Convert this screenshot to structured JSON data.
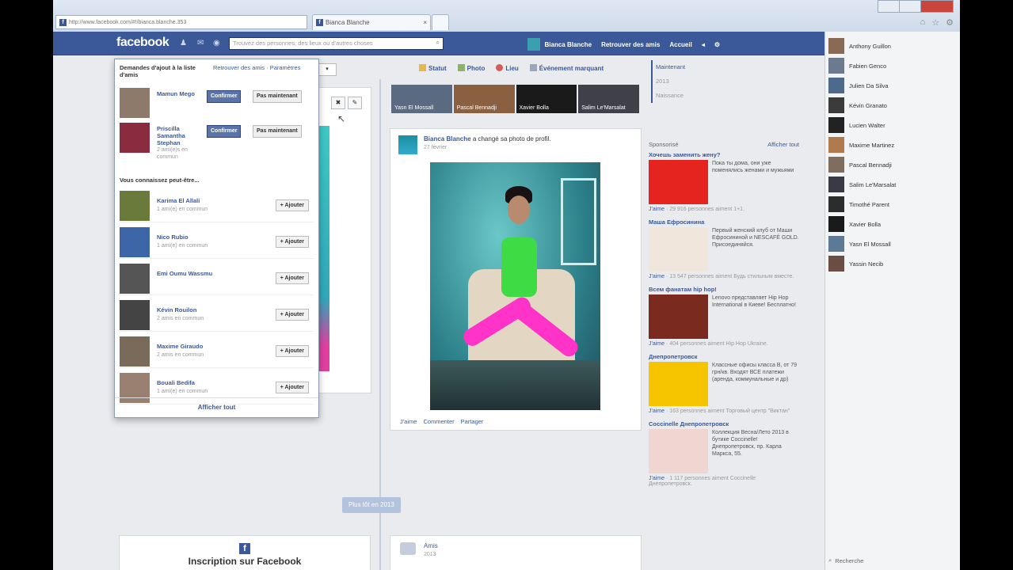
{
  "browser": {
    "url": "http://www.facebook.com/#!/bianca.blanche.353",
    "tab_label": "Bianca Blanche"
  },
  "fbbar": {
    "logo": "facebook",
    "search_placeholder": "Trouvez des personnes, des lieux ou d'autres choses",
    "profile_name": "Bianca Blanche",
    "find_friends": "Retrouver des amis",
    "home": "Accueil"
  },
  "actionbar": {
    "status": "Statut",
    "photo": "Photo",
    "place": "Lieu",
    "event": "Événement marquant"
  },
  "photostrip": [
    "Yasn El Mossall",
    "Pascal Bennadji",
    "Xavier Bolla",
    "Salim Le'Marsalat"
  ],
  "post": {
    "author": "Bianca Blanche",
    "action": "a changé sa photo de profil.",
    "time": "27 février",
    "like": "J'aime",
    "comment": "Commenter",
    "share": "Partager"
  },
  "yearnav": [
    "Maintenant",
    "2013",
    "Naissance"
  ],
  "more_button": "Plus tôt en 2013",
  "signup": "Inscription sur Facebook",
  "amis": {
    "title": "Amis",
    "year": "2013"
  },
  "sponsored": {
    "label": "Sponsorisé",
    "show_all": "Afficher tout",
    "ads": [
      {
        "title": "Хочешь заменить жену?",
        "text": "Пока ты дома, они уже поменялись женами и мужьями",
        "like": "J'aime",
        "count": "29 916 personnes aiment 1+1.",
        "color": "#e52420"
      },
      {
        "title": "Маша Ефросинина",
        "text": "Первый женский клуб от Маши Ефросининой и NESCAFÉ GOLD. Присоединяйся.",
        "like": "J'aime",
        "count": "13 547 personnes aiment Будь стильным вместе.",
        "color": "#f1e6dc"
      },
      {
        "title": "Всем фанатам hip hop!",
        "text": "Lenovo представляет Hip Hop International в Киеве! Бесплатно!",
        "like": "J'aime",
        "count": "404 personnes aiment Hip Hop Ukraine.",
        "color": "#7a2a1f"
      },
      {
        "title": "Днепропетровск",
        "text": "Классные офисы класса B, от 79 грн/кв. Входят ВСЕ платежи (аренда, коммунальные и др)",
        "like": "J'aime",
        "count": "163 personnes aiment Торговый центр \"Виктан\"",
        "color": "#f7c400"
      },
      {
        "title": "Coccinelle Днепропетровск",
        "text": "Коллекция Весна/Лето 2013 в бутике Coccinelle! Днепропетровск, пр. Карла Маркса, 55.",
        "like": "J'aime",
        "count": "1 117 personnes aiment Coccinelle Днепропетровск.",
        "color": "#f0d6d0"
      }
    ]
  },
  "dropdown": {
    "title": "Demandes d'ajout à la liste d'amis",
    "find": "Retrouver des amis",
    "settings": "Paramètres",
    "requests": [
      {
        "name": "Mamun Mego",
        "mutual": "",
        "confirm": "Confirmer",
        "later": "Pas maintenant"
      },
      {
        "name": "Priscilla Samantha Stephan",
        "mutual": "2 ami(e)s en commun",
        "confirm": "Confirmer",
        "later": "Pas maintenant"
      }
    ],
    "suggest_title": "Vous connaissez peut-être...",
    "suggestions": [
      {
        "name": "Karima El Allali",
        "mutual": "1 ami(e) en commun",
        "add": "Ajouter"
      },
      {
        "name": "Nico Rubio",
        "mutual": "1 ami(e) en commun",
        "add": "Ajouter"
      },
      {
        "name": "Emi Oumu Wassmu",
        "mutual": "",
        "add": "Ajouter"
      },
      {
        "name": "Kévin Rouilon",
        "mutual": "2 amis en commun",
        "add": "Ajouter"
      },
      {
        "name": "Maxime Giraudo",
        "mutual": "2 amis en commun",
        "add": "Ajouter"
      },
      {
        "name": "Bouali Bedifa",
        "mutual": "1 ami(e) en commun",
        "add": "Ajouter"
      }
    ],
    "show_all": "Afficher tout"
  },
  "chat": {
    "friends": [
      {
        "name": "Anthony Guillon",
        "color": "#8a6a55"
      },
      {
        "name": "Fabien Genco",
        "color": "#6c7a90"
      },
      {
        "name": "Julien Da Silva",
        "color": "#4d6a8c"
      },
      {
        "name": "Kévin Granato",
        "color": "#3b3b3b"
      },
      {
        "name": "Lucien Walter",
        "color": "#222"
      },
      {
        "name": "Maxime Martinez",
        "color": "#b07a4e"
      },
      {
        "name": "Pascal Bennadji",
        "color": "#7f6d60"
      },
      {
        "name": "Salim Le'Marsalat",
        "color": "#3a3a45"
      },
      {
        "name": "Timothé Parent",
        "color": "#2c2c2c"
      },
      {
        "name": "Xavier Bolla",
        "color": "#1a1a1a"
      },
      {
        "name": "Yasn El Mossall",
        "color": "#5c7a95"
      },
      {
        "name": "Yassin Necib",
        "color": "#6b4e43"
      }
    ],
    "search": "Recherche"
  }
}
